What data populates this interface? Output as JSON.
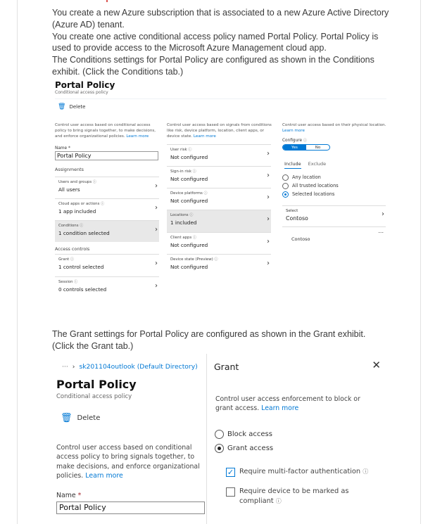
{
  "intro": {
    "lines": [
      "You create a new Azure subscription that is associated to a new Azure Active Directory (Azure AD) tenant.",
      "You create one active conditional access policy named Portal Policy. Portal Policy is used to provide access to the Microsoft Azure Management cloud app.",
      "The Conditions settings for Portal Policy are configured as shown in the Conditions exhibit. (Click the Conditions tab.)"
    ]
  },
  "conditions_exhibit": {
    "title": "Portal Policy",
    "subtitle": "Conditional access policy",
    "delete_label": "Delete",
    "left": {
      "description": "Control user access based on conditional access policy to bring signals together, to make decisions, and enforce organizational policies.",
      "learn_more": "Learn more",
      "name_label": "Name *",
      "name_value": "Portal Policy",
      "assignments_label": "Assignments",
      "cards": [
        {
          "caption": "Users and groups",
          "value": "All users"
        },
        {
          "caption": "Cloud apps or actions",
          "value": "1 app included"
        },
        {
          "caption": "Conditions",
          "value": "1 condition selected"
        }
      ],
      "access_controls_label": "Access controls",
      "controls": [
        {
          "caption": "Grant",
          "value": "1 control selected"
        },
        {
          "caption": "Session",
          "value": "0 controls selected"
        }
      ]
    },
    "middle": {
      "description": "Control user access based on signals from conditions like risk, device platform, location, client apps, or device state.",
      "learn_more": "Learn more",
      "cards": [
        {
          "caption": "User risk",
          "value": "Not configured"
        },
        {
          "caption": "Sign-in risk",
          "value": "Not configured"
        },
        {
          "caption": "Device platforms",
          "value": "Not configured"
        },
        {
          "caption": "Locations",
          "value": "1 included"
        },
        {
          "caption": "Client apps",
          "value": "Not configured"
        },
        {
          "caption": "Device state (Preview)",
          "value": "Not configured"
        }
      ]
    },
    "right": {
      "description": "Control user access based on their physical location.",
      "learn_more": "Learn more",
      "configure_label": "Configure",
      "toggle_yes": "Yes",
      "toggle_no": "No",
      "tab_include": "Include",
      "tab_exclude": "Exclude",
      "options": [
        "Any location",
        "All trusted locations",
        "Selected locations"
      ],
      "select_label": "Select",
      "select_value": "Contoso",
      "list_item": "Contoso",
      "list_more": "..."
    }
  },
  "mid_text": "The Grant settings for Portal Policy are configured as shown in the Grant exhibit. (Click the Grant tab.)",
  "grant_exhibit": {
    "breadcrumb_dots": "···",
    "breadcrumb": "sk201104outlook (Default Directory)",
    "title": "Portal Policy",
    "subtitle": "Conditional access policy",
    "delete_label": "Delete",
    "description": "Control user access based on conditional access policy to bring signals together, to make decisions, and enforce organizational policies.",
    "learn_more": "Learn more",
    "name_label": "Name",
    "name_required": "*",
    "name_value": "Portal Policy",
    "panel": {
      "title": "Grant",
      "description": "Control user access enforcement to block or grant access.",
      "learn_more": "Learn more",
      "block_access": "Block access",
      "grant_access": "Grant access",
      "require_mfa": "Require multi-factor authentication",
      "require_compliant": "Require device to be marked as compliant"
    }
  },
  "colors": {
    "accent": "#0078d4",
    "text": "#3a3a3a"
  }
}
